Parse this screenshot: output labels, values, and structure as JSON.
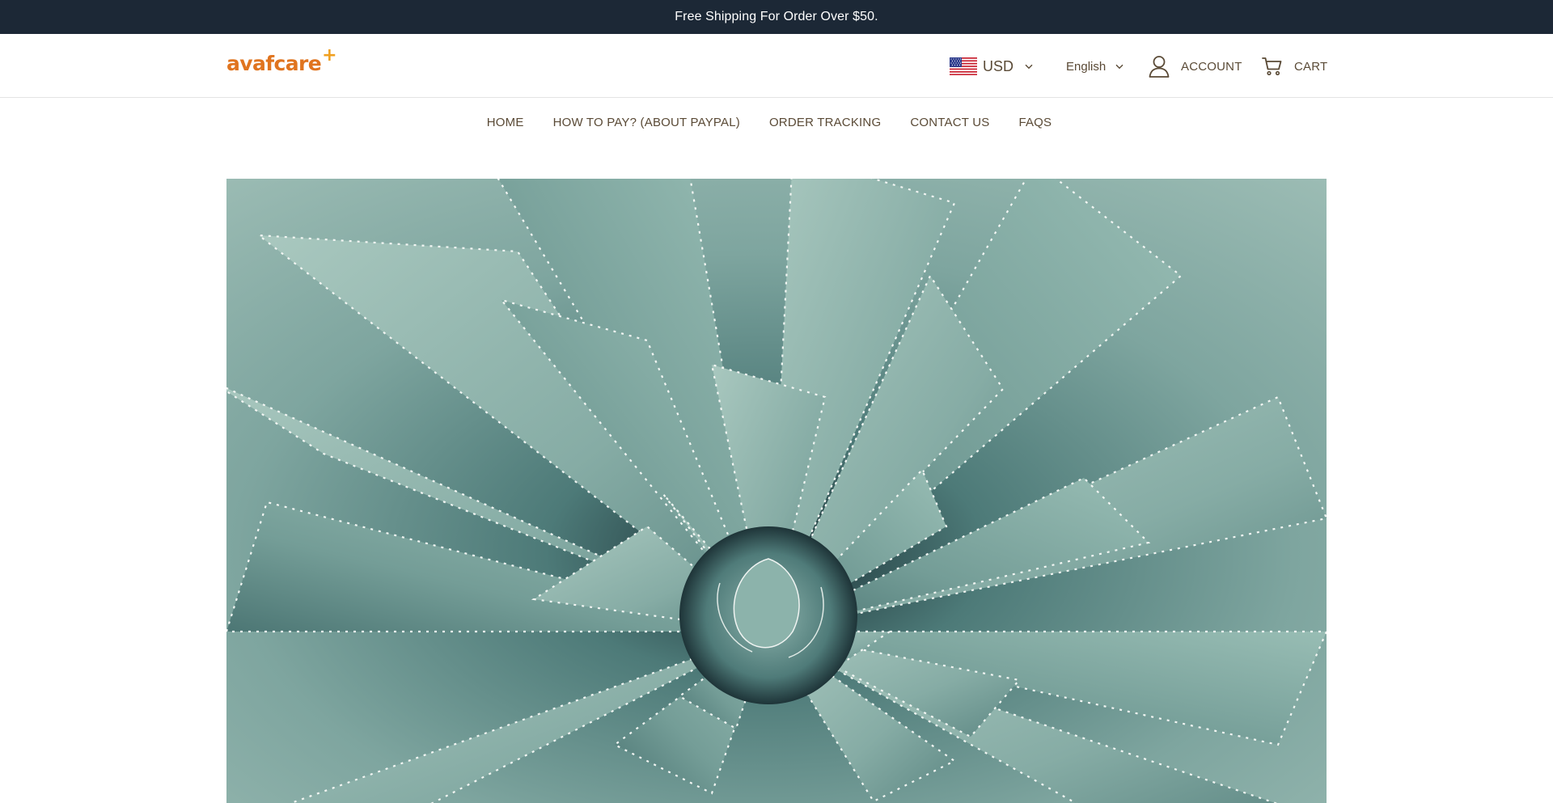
{
  "announcement": {
    "text": "Free Shipping For Order Over $50."
  },
  "header": {
    "logo": {
      "text": "avafcare",
      "mark": "+"
    },
    "currency": {
      "code": "USD",
      "flag_icon": "us-flag-icon"
    },
    "language": {
      "label": "English"
    },
    "account": {
      "label": "ACCOUNT",
      "icon": "user-icon"
    },
    "cart": {
      "label": "CART",
      "icon": "cart-icon"
    }
  },
  "nav": {
    "items": [
      {
        "label": "HOME"
      },
      {
        "label": "HOW TO PAY? (ABOUT PAYPAL)"
      },
      {
        "label": "ORDER TRACKING"
      },
      {
        "label": "CONTACT US"
      },
      {
        "label": "FAQS"
      }
    ]
  },
  "hero": {
    "image": "agave-succulent-closeup"
  },
  "colors": {
    "announcement_bg": "#1c2836",
    "text": "#5a4a36",
    "logo": "#e0741f",
    "hero_tone": "#7ea59f"
  }
}
